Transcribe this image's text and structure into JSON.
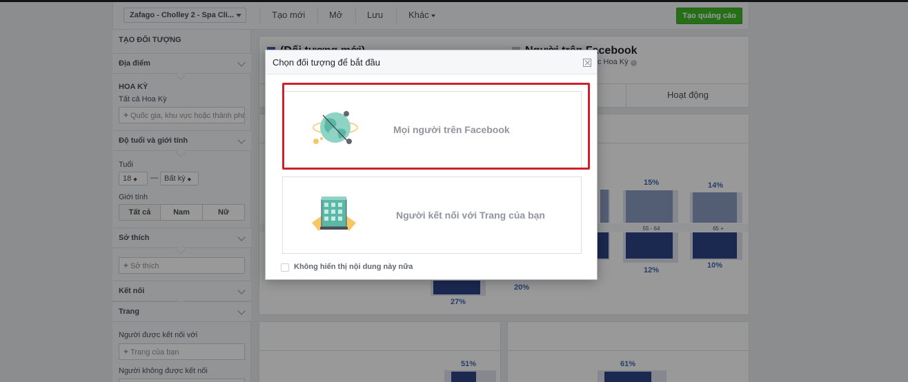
{
  "toolbar": {
    "account": "Zafago - Cholley 2 - Spa Cli...",
    "items": [
      "Tạo mới",
      "Mở",
      "Lưu",
      "Khác"
    ],
    "create_ad": "Tạo quảng cáo"
  },
  "sidebar": {
    "title": "TẠO ĐỐI TƯỢNG",
    "location": {
      "label": "Địa điểm",
      "country": "HOA KỲ",
      "all": "Tất cả Hoa Kỳ",
      "placeholder": "Quốc gia, khu vực hoặc thành phố"
    },
    "age_gender": {
      "label": "Độ tuổi và giới tính",
      "age_label": "Tuổi",
      "age_min": "18",
      "age_max": "Bất kỳ",
      "gender_label": "Giới tính",
      "genders": [
        "Tất cả",
        "Nam",
        "Nữ"
      ]
    },
    "interests": {
      "label": "Sở thích",
      "placeholder": "Sở thích"
    },
    "connections": "Kết nối",
    "pages": {
      "label": "Trang",
      "connected_label": "Người được kết nối với",
      "connected_placeholder": "Trang của bạn",
      "not_connected_label": "Người không được kết nối"
    }
  },
  "main": {
    "header_left": "(Đối tượng mới)",
    "header_right": "Người trên Facebook",
    "header_sub": "c Hoa Kỳ",
    "tab_activity": "Hoạt động",
    "colors": {
      "bar": "#2d4486",
      "bar_light": "#8b9dc3",
      "highlight": "#d0202a",
      "create_button": "#42b72a"
    }
  },
  "age_chart": {
    "age_groups": [
      "55 - 64",
      "65 +"
    ],
    "top_values": [
      "15%",
      "14%"
    ],
    "bottom_values": [
      "12%",
      "10%"
    ],
    "extra_labels": [
      "27%",
      "20%"
    ]
  },
  "lower_chart": {
    "values": [
      "51%",
      "61%"
    ]
  },
  "modal": {
    "title": "Chọn đối tượng để bắt đầu",
    "option_everyone": "Mọi người trên Facebook",
    "option_page": "Người kết nối với Trang của bạn",
    "dont_show": "Không hiển thị nội dung này nữa"
  }
}
